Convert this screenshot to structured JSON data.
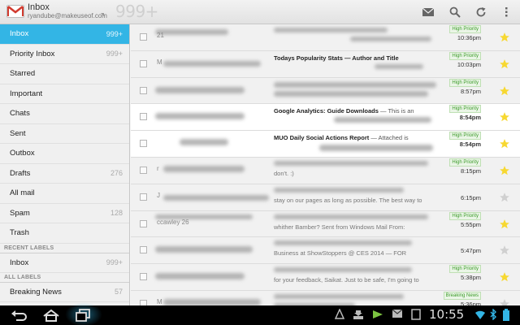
{
  "header": {
    "title": "Inbox",
    "account_email": "ryandube@makeuseof.com",
    "big_count": "999+"
  },
  "sidebar": {
    "items": [
      {
        "label": "Inbox",
        "count": "999+",
        "active": true
      },
      {
        "label": "Priority Inbox",
        "count": "999+"
      },
      {
        "label": "Starred",
        "count": ""
      },
      {
        "label": "Important",
        "count": ""
      },
      {
        "label": "Chats",
        "count": ""
      },
      {
        "label": "Sent",
        "count": ""
      },
      {
        "label": "Outbox",
        "count": ""
      },
      {
        "label": "Drafts",
        "count": "276"
      },
      {
        "label": "All mail",
        "count": ""
      },
      {
        "label": "Spam",
        "count": "128"
      },
      {
        "label": "Trash",
        "count": ""
      }
    ],
    "recent_label_header": "RECENT LABELS",
    "recent_items": [
      {
        "label": "Inbox",
        "count": "999+"
      }
    ],
    "all_labels_header": "ALL LABELS",
    "all_items": [
      {
        "label": "Breaking News",
        "count": "57"
      }
    ]
  },
  "messages": [
    {
      "sender": "21",
      "subject": "",
      "snippet": "",
      "tag": "High Priority",
      "time": "10:36pm",
      "starred": true,
      "unread": false
    },
    {
      "sender": "M",
      "subject": "Todays Popularity Stats — Author and Title",
      "snippet": "",
      "tag": "High Priority",
      "time": "10:03pm",
      "starred": true,
      "unread": false
    },
    {
      "sender": "",
      "subject": "",
      "snippet": "",
      "tag": "High Priority",
      "time": "8:57pm",
      "starred": true,
      "unread": false
    },
    {
      "sender": "",
      "subject": "Google Analytics: Guide Downloads",
      "snippet": "— This is an",
      "tag": "High Priority",
      "time": "8:54pm",
      "starred": true,
      "unread": true
    },
    {
      "sender": "",
      "subject": "MUO Daily Social Actions Report",
      "snippet": "— Attached is",
      "tag": "High Priority",
      "time": "8:54pm",
      "starred": true,
      "unread": true
    },
    {
      "sender": "r",
      "subject": "",
      "snippet": "don't. :)",
      "tag": "High Priority",
      "time": "8:15pm",
      "starred": true,
      "unread": false
    },
    {
      "sender": "J",
      "subject": "",
      "snippet": "stay on our pages as long as possible. The best way to",
      "tag": "",
      "time": "6:15pm",
      "starred": false,
      "unread": false
    },
    {
      "sender": "ccawley  26",
      "subject": "",
      "snippet": "whither Bamber? Sent from Windows Mail From:",
      "tag": "High Priority",
      "time": "5:55pm",
      "starred": true,
      "unread": false
    },
    {
      "sender": "",
      "subject": "",
      "snippet": "Business at ShowStoppers @ CES 2014 — FOR",
      "tag": "",
      "time": "5:47pm",
      "starred": false,
      "unread": false
    },
    {
      "sender": "",
      "subject": "",
      "snippet": "for your feedback, Saikat. Just to be safe, I'm going to",
      "tag": "High Priority",
      "time": "5:38pm",
      "starred": true,
      "unread": false
    },
    {
      "sender": "M",
      "subject": "",
      "snippet": "",
      "tag": "Breaking News",
      "time": "5:36pm",
      "starred": false,
      "unread": false
    }
  ],
  "status": {
    "clock": "10:55"
  },
  "colors": {
    "accent": "#33b5e5",
    "star": "#f7d831",
    "tag_green": "#3a9a28"
  }
}
